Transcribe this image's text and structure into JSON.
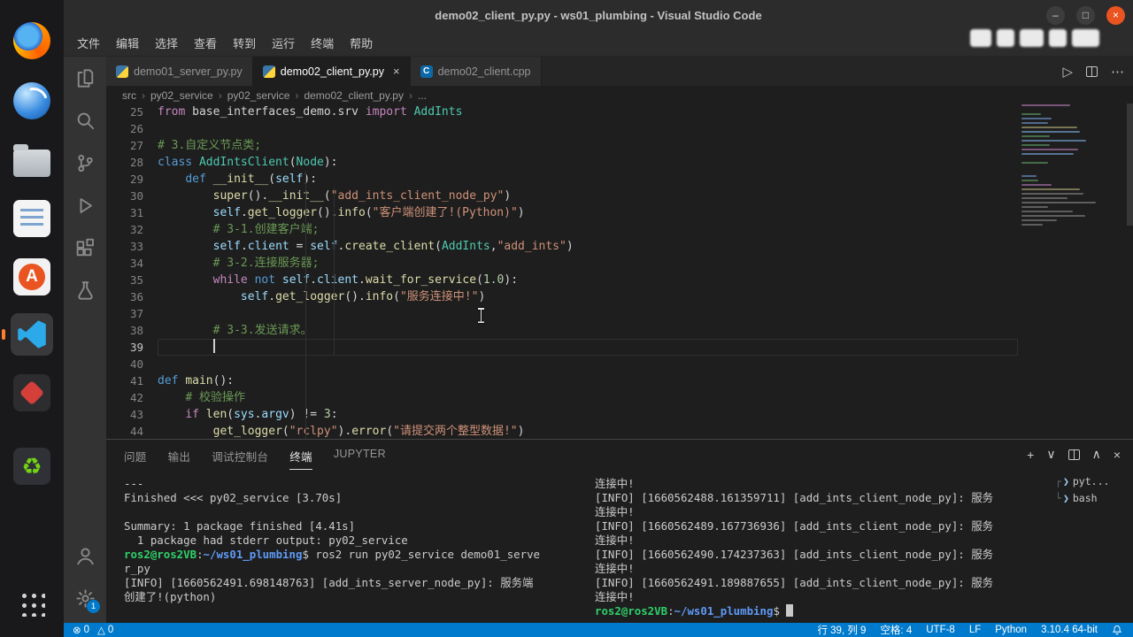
{
  "window": {
    "title": "demo02_client_py.py - ws01_plumbing - Visual Studio Code",
    "controls": [
      {
        "name": "minimize",
        "glyph": "–"
      },
      {
        "name": "maximize",
        "glyph": "□"
      },
      {
        "name": "close",
        "glyph": "×"
      }
    ]
  },
  "menu": {
    "items": [
      {
        "name": "file",
        "label": "文件"
      },
      {
        "name": "edit",
        "label": "编辑"
      },
      {
        "name": "selection",
        "label": "选择"
      },
      {
        "name": "view",
        "label": "查看"
      },
      {
        "name": "go",
        "label": "转到"
      },
      {
        "name": "run",
        "label": "运行"
      },
      {
        "name": "terminal",
        "label": "终端"
      },
      {
        "name": "help",
        "label": "帮助"
      }
    ]
  },
  "dock": {
    "items": [
      {
        "name": "firefox-icon",
        "icon": "firefox"
      },
      {
        "name": "globe-app-icon",
        "icon": "globe"
      },
      {
        "name": "files-icon",
        "icon": "folder"
      },
      {
        "name": "text-editor-icon",
        "icon": "doc"
      },
      {
        "name": "app-store-icon",
        "icon": "appstore",
        "glyph": "A"
      },
      {
        "name": "vscode-icon",
        "icon": "vscode",
        "active": true
      },
      {
        "name": "red-app-icon",
        "icon": "redapp"
      },
      {
        "name": "green-app-icon",
        "icon": "greenapp",
        "glyph": "♻"
      },
      {
        "name": "show-apps-icon",
        "icon": "grid"
      }
    ]
  },
  "activity_bar": {
    "top": [
      {
        "name": "explorer"
      },
      {
        "name": "search"
      },
      {
        "name": "source-control"
      },
      {
        "name": "run-debug"
      },
      {
        "name": "extensions"
      },
      {
        "name": "testing"
      }
    ],
    "bottom": [
      {
        "name": "account"
      },
      {
        "name": "settings",
        "badge": "1"
      }
    ]
  },
  "tabs": [
    {
      "label": "demo01_server_py.py",
      "icon": "python",
      "active": false
    },
    {
      "label": "demo02_client_py.py",
      "icon": "python",
      "active": true,
      "close_glyph": "×"
    },
    {
      "label": "demo02_client.cpp",
      "icon": "cpp",
      "icon_glyph": "C",
      "active": false
    }
  ],
  "editor_actions": [
    {
      "name": "run-button",
      "glyph": "▷"
    },
    {
      "name": "split-editor-button",
      "glyph": ""
    },
    {
      "name": "more-actions-button",
      "glyph": "⋯"
    }
  ],
  "breadcrumb": {
    "separator": "›",
    "items": [
      "src",
      "py02_service",
      "py02_service",
      "demo02_client_py.py",
      "..."
    ]
  },
  "editor": {
    "cursor": {
      "line": 39,
      "col": 9
    },
    "lines": [
      {
        "n": 25,
        "t": [
          [
            "k",
            "from"
          ],
          [
            "d",
            " base_interfaces_demo.srv "
          ],
          [
            "k",
            "import"
          ],
          [
            "c",
            " AddInts"
          ]
        ]
      },
      {
        "n": 26,
        "t": []
      },
      {
        "n": 27,
        "t": [
          [
            "m",
            "# 3.自定义节点类;"
          ]
        ]
      },
      {
        "n": 28,
        "t": [
          [
            "b",
            "class"
          ],
          [
            "d",
            " "
          ],
          [
            "c",
            "AddIntsClient"
          ],
          [
            "d",
            "("
          ],
          [
            "c",
            "Node"
          ],
          [
            "d",
            "):"
          ]
        ]
      },
      {
        "n": 29,
        "t": [
          [
            "d",
            "    "
          ],
          [
            "b",
            "def"
          ],
          [
            "d",
            " "
          ],
          [
            "f",
            "__init__"
          ],
          [
            "d",
            "("
          ],
          [
            "v",
            "self"
          ],
          [
            "d",
            "):"
          ]
        ]
      },
      {
        "n": 30,
        "t": [
          [
            "d",
            "        "
          ],
          [
            "f",
            "super"
          ],
          [
            "d",
            "()."
          ],
          [
            "f",
            "__init__"
          ],
          [
            "d",
            "("
          ],
          [
            "s",
            "\"add_ints_client_node_py\""
          ],
          [
            "d",
            ")"
          ]
        ]
      },
      {
        "n": 31,
        "t": [
          [
            "d",
            "        "
          ],
          [
            "v",
            "self"
          ],
          [
            "d",
            "."
          ],
          [
            "f",
            "get_logger"
          ],
          [
            "d",
            "()."
          ],
          [
            "f",
            "info"
          ],
          [
            "d",
            "("
          ],
          [
            "s",
            "\"客户端创建了!(Python)\""
          ],
          [
            "d",
            ")"
          ]
        ]
      },
      {
        "n": 32,
        "t": [
          [
            "d",
            "        "
          ],
          [
            "m",
            "# 3-1.创建客户端;"
          ]
        ]
      },
      {
        "n": 33,
        "t": [
          [
            "d",
            "        "
          ],
          [
            "v",
            "self"
          ],
          [
            "d",
            "."
          ],
          [
            "v",
            "client"
          ],
          [
            "d",
            " = "
          ],
          [
            "v",
            "self"
          ],
          [
            "d",
            "."
          ],
          [
            "f",
            "create_client"
          ],
          [
            "d",
            "("
          ],
          [
            "c",
            "AddInts"
          ],
          [
            "d",
            ","
          ],
          [
            "s",
            "\"add_ints\""
          ],
          [
            "d",
            ")"
          ]
        ]
      },
      {
        "n": 34,
        "t": [
          [
            "d",
            "        "
          ],
          [
            "m",
            "# 3-2.连接服务器;"
          ]
        ]
      },
      {
        "n": 35,
        "t": [
          [
            "d",
            "        "
          ],
          [
            "k",
            "while"
          ],
          [
            "d",
            " "
          ],
          [
            "b",
            "not"
          ],
          [
            "d",
            " "
          ],
          [
            "v",
            "self"
          ],
          [
            "d",
            "."
          ],
          [
            "v",
            "client"
          ],
          [
            "d",
            "."
          ],
          [
            "f",
            "wait_for_service"
          ],
          [
            "d",
            "("
          ],
          [
            "n",
            "1.0"
          ],
          [
            "d",
            "):"
          ]
        ]
      },
      {
        "n": 36,
        "t": [
          [
            "d",
            "            "
          ],
          [
            "v",
            "self"
          ],
          [
            "d",
            "."
          ],
          [
            "f",
            "get_logger"
          ],
          [
            "d",
            "()."
          ],
          [
            "f",
            "info"
          ],
          [
            "d",
            "("
          ],
          [
            "s",
            "\"服务连接中!\""
          ],
          [
            "d",
            ")"
          ]
        ]
      },
      {
        "n": 37,
        "t": []
      },
      {
        "n": 38,
        "t": [
          [
            "d",
            "        "
          ],
          [
            "m",
            "# 3-3.发送请求。"
          ]
        ]
      },
      {
        "n": 39,
        "t": [
          [
            "d",
            "        "
          ]
        ]
      },
      {
        "n": 40,
        "t": []
      },
      {
        "n": 41,
        "t": [
          [
            "b",
            "def"
          ],
          [
            "d",
            " "
          ],
          [
            "f",
            "main"
          ],
          [
            "d",
            "():"
          ]
        ]
      },
      {
        "n": 42,
        "t": [
          [
            "d",
            "    "
          ],
          [
            "m",
            "# 校验操作"
          ]
        ]
      },
      {
        "n": 43,
        "t": [
          [
            "d",
            "    "
          ],
          [
            "k",
            "if"
          ],
          [
            "d",
            " "
          ],
          [
            "f",
            "len"
          ],
          [
            "d",
            "("
          ],
          [
            "v",
            "sys"
          ],
          [
            "d",
            "."
          ],
          [
            "v",
            "argv"
          ],
          [
            "d",
            ") != "
          ],
          [
            "n",
            "3"
          ],
          [
            "d",
            ":"
          ]
        ]
      },
      {
        "n": 44,
        "t": [
          [
            "d",
            "        "
          ],
          [
            "f",
            "get_logger"
          ],
          [
            "d",
            "("
          ],
          [
            "s",
            "\"rclpy\""
          ],
          [
            "d",
            ")."
          ],
          [
            "f",
            "error"
          ],
          [
            "d",
            "("
          ],
          [
            "s",
            "\"请提交两个整型数据!\""
          ],
          [
            "d",
            ")"
          ]
        ]
      }
    ]
  },
  "panel": {
    "tabs": [
      {
        "name": "problems",
        "label": "问题"
      },
      {
        "name": "output",
        "label": "输出"
      },
      {
        "name": "debug-console",
        "label": "调试控制台"
      },
      {
        "name": "terminal",
        "label": "终端",
        "active": true
      },
      {
        "name": "jupyter",
        "label": "JUPYTER"
      }
    ],
    "actions": [
      {
        "name": "new-terminal",
        "glyph": "+"
      },
      {
        "name": "terminal-profile",
        "glyph": "∨"
      },
      {
        "name": "split-terminal",
        "glyph": ""
      },
      {
        "name": "maximize-panel",
        "glyph": "∧"
      },
      {
        "name": "close-panel",
        "glyph": "×"
      }
    ],
    "terminal_left": [
      {
        "s": [
          [
            "t",
            "---"
          ]
        ]
      },
      {
        "s": [
          [
            "t",
            "Finished <<< py02_service [3.70s]"
          ]
        ]
      },
      {
        "s": []
      },
      {
        "s": [
          [
            "t",
            "Summary: 1 package finished [4.41s]"
          ]
        ]
      },
      {
        "s": [
          [
            "t",
            "  1 package had stderr output: py02_service"
          ]
        ]
      },
      {
        "deco": true,
        "s": [
          [
            "g",
            "ros2@ros2VB"
          ],
          [
            "t",
            ":"
          ],
          [
            "bl",
            "~/ws01_plumbing"
          ],
          [
            "t",
            "$ ros2 run py02_service demo01_serve"
          ]
        ]
      },
      {
        "s": [
          [
            "t",
            "r_py"
          ]
        ]
      },
      {
        "s": [
          [
            "t",
            "[INFO] [1660562491.698148763] [add_ints_server_node_py]: 服务端"
          ]
        ]
      },
      {
        "s": [
          [
            "t",
            "创建了!(python)"
          ]
        ]
      }
    ],
    "terminal_right": [
      {
        "s": [
          [
            "t",
            "连接中!"
          ]
        ]
      },
      {
        "s": [
          [
            "t",
            "[INFO] [1660562488.161359711] [add_ints_client_node_py]: 服务"
          ]
        ]
      },
      {
        "s": [
          [
            "t",
            "连接中!"
          ]
        ]
      },
      {
        "s": [
          [
            "t",
            "[INFO] [1660562489.167736936] [add_ints_client_node_py]: 服务"
          ]
        ]
      },
      {
        "s": [
          [
            "t",
            "连接中!"
          ]
        ]
      },
      {
        "s": [
          [
            "t",
            "[INFO] [1660562490.174237363] [add_ints_client_node_py]: 服务"
          ]
        ]
      },
      {
        "s": [
          [
            "t",
            "连接中!"
          ]
        ]
      },
      {
        "s": [
          [
            "t",
            "[INFO] [1660562491.189887655] [add_ints_client_node_py]: 服务"
          ]
        ]
      },
      {
        "s": [
          [
            "t",
            "连接中!"
          ]
        ]
      },
      {
        "deco": true,
        "cursor": true,
        "s": [
          [
            "g",
            "ros2@ros2VB"
          ],
          [
            "t",
            ":"
          ],
          [
            "bl",
            "~/ws01_plumbing"
          ],
          [
            "t",
            "$ "
          ]
        ]
      }
    ],
    "terminal_list": [
      {
        "name": "terminal-item-python",
        "tree": "┌",
        "icon": "❯",
        "label": "pyt..."
      },
      {
        "name": "terminal-item-bash",
        "tree": "└",
        "icon": "❯",
        "label": "bash"
      }
    ]
  },
  "status_bar": {
    "left": [
      {
        "name": "errors",
        "glyph": "⊗",
        "value": "0"
      },
      {
        "name": "warnings",
        "glyph": "△",
        "value": "0"
      }
    ],
    "right": [
      "行 39, 列 9",
      "空格: 4",
      "UTF-8",
      "LF",
      "Python",
      "3.10.4 64-bit"
    ]
  }
}
